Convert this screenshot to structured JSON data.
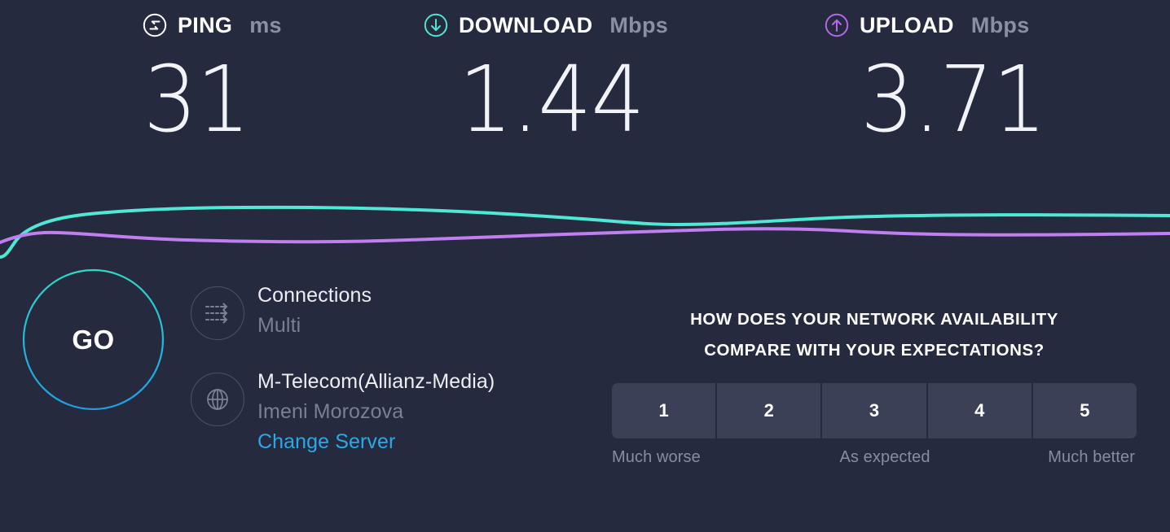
{
  "results": {
    "metrics": [
      {
        "id": "ping",
        "icon": "ping-icon",
        "title": "PING",
        "unit": "ms",
        "value": "31",
        "accent": "#ffffff"
      },
      {
        "id": "download",
        "icon": "download-arrow-icon",
        "title": "DOWNLOAD",
        "unit": "Mbps",
        "value": "1.44",
        "accent": "#4fe3d0"
      },
      {
        "id": "upload",
        "icon": "upload-arrow-icon",
        "title": "UPLOAD",
        "unit": "Mbps",
        "value": "3.71",
        "accent": "#b368e8"
      }
    ]
  },
  "graph": {
    "download_color": "#4fe8d6",
    "upload_color": "#c07ef0"
  },
  "go_button": {
    "label": "GO",
    "ring_top_color": "#2ed9c3",
    "ring_bottom_color": "#1f9fe0"
  },
  "server_info": {
    "connections": {
      "icon": "connections-icon",
      "label": "Connections",
      "value": "Multi"
    },
    "provider": {
      "icon": "globe-icon",
      "label": "M-Telecom(Allianz-Media)",
      "location": "Imeni Morozova",
      "change_server_label": "Change Server",
      "link_color": "#2aa9e8"
    }
  },
  "survey": {
    "question_line1": "HOW DOES YOUR NETWORK AVAILABILITY",
    "question_line2": "COMPARE WITH YOUR EXPECTATIONS?",
    "ratings": [
      "1",
      "2",
      "3",
      "4",
      "5"
    ],
    "legend": {
      "low": "Much worse",
      "mid": "As expected",
      "high": "Much better"
    }
  }
}
